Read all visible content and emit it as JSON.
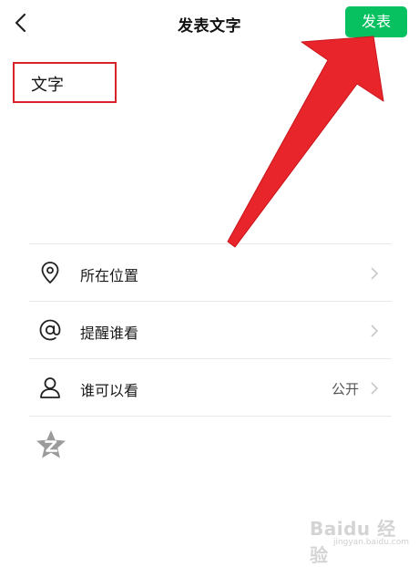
{
  "header": {
    "back_icon": "chevron-left-icon",
    "title": "发表文字",
    "publish_label": "发表",
    "publish_color": "#07c160"
  },
  "content": {
    "text": "文字",
    "highlight_color": "#d8232a"
  },
  "menu": [
    {
      "icon": "location-pin-icon",
      "label": "所在位置",
      "value": ""
    },
    {
      "icon": "at-sign-icon",
      "label": "提醒谁看",
      "value": ""
    },
    {
      "icon": "person-icon",
      "label": "谁可以看",
      "value": "公开"
    }
  ],
  "extra": {
    "icon": "star-badge-icon"
  },
  "annotation": {
    "arrow_color": "#e8252b"
  },
  "watermark": {
    "main": "Baidu 经验",
    "sub": "jingyan.baidu.com"
  }
}
